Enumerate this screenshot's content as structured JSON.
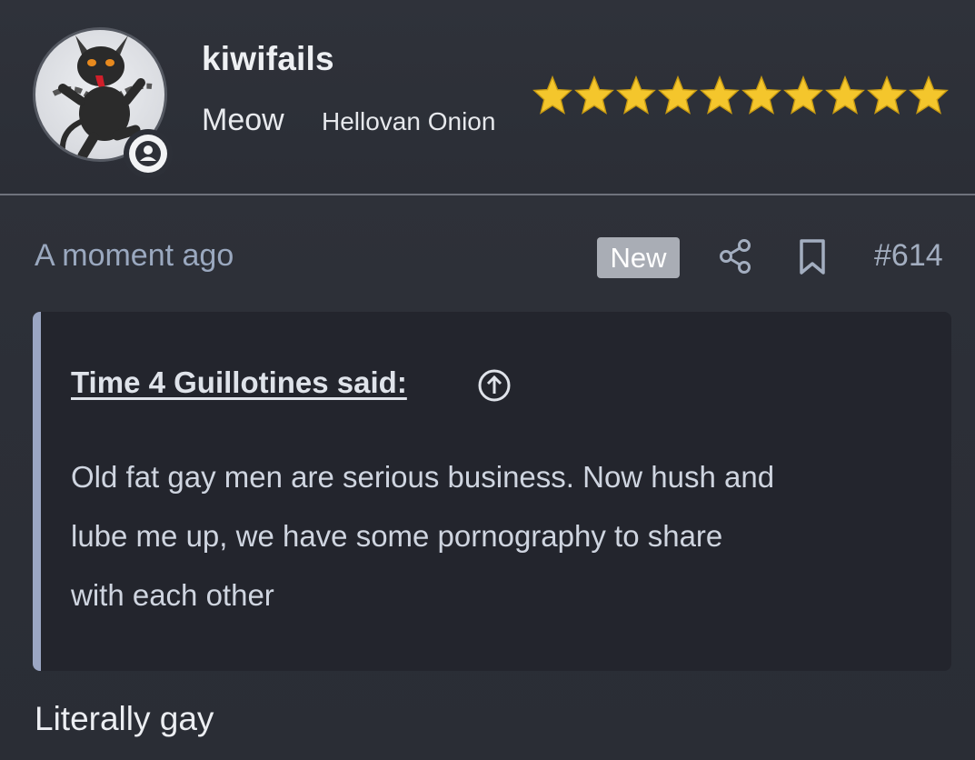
{
  "user": {
    "name": "kiwifails",
    "title": "Meow",
    "banner": "Hellovan Onion",
    "rating_stars": 10,
    "star_color": "#f4c62c",
    "avatar_icon": "devil-cat-avatar",
    "status_icon": "user-icon"
  },
  "post": {
    "timestamp": "A moment ago",
    "badge": "New",
    "share_icon": "share-icon",
    "bookmark_icon": "bookmark-icon",
    "number": "#614",
    "quote": {
      "author_line": "Time 4 Guillotines said:",
      "jump_icon": "arrow-up-circle-icon",
      "lines": [
        "Old fat gay men are serious business. Now hush and",
        "lube me up, we have some pornography to share",
        "with each other"
      ],
      "accent_color": "#9ba6c3"
    },
    "reply": "Literally gay"
  }
}
